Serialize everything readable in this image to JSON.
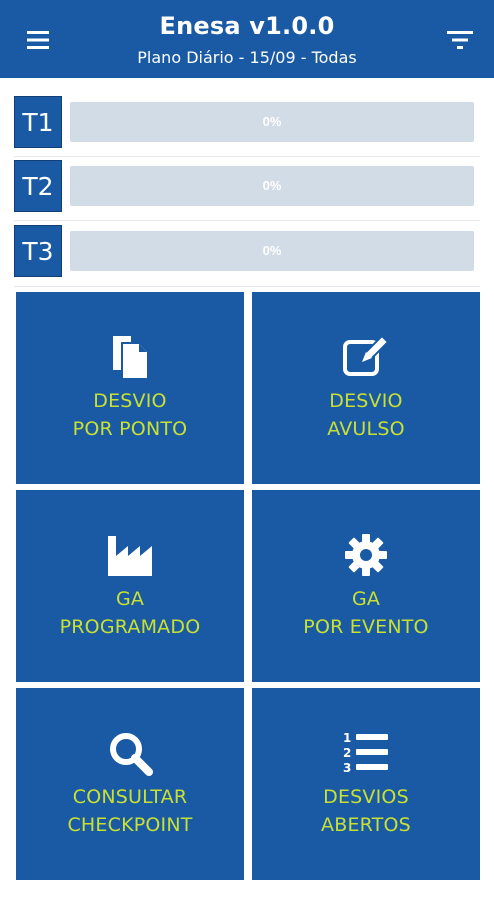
{
  "header": {
    "title": "Enesa v1.0.0",
    "subtitle": "Plano Diário - 15/09 - Todas",
    "menu_icon": "hamburger-menu-icon",
    "filter_icon": "filter-icon",
    "background": "#1a5aa5"
  },
  "progress": [
    {
      "label": "T1",
      "percent_text": "0%",
      "value": 0
    },
    {
      "label": "T2",
      "percent_text": "0%",
      "value": 0
    },
    {
      "label": "T3",
      "percent_text": "0%",
      "value": 0
    }
  ],
  "tiles": [
    {
      "line1": "DESVIO",
      "line2": "POR PONTO",
      "icon": "documents-icon"
    },
    {
      "line1": "DESVIO",
      "line2": "AVULSO",
      "icon": "edit-icon"
    },
    {
      "line1": "GA",
      "line2": "PROGRAMADO",
      "icon": "factory-icon"
    },
    {
      "line1": "GA",
      "line2": "POR EVENTO",
      "icon": "gear-icon"
    },
    {
      "line1": "CONSULTAR",
      "line2": "CHECKPOINT",
      "icon": "search-icon"
    },
    {
      "line1": "DESVIOS",
      "line2": "ABERTOS",
      "icon": "numbered-list-icon"
    }
  ],
  "colors": {
    "primary": "#1a5aa5",
    "tile_text": "#c8e032",
    "bar_track": "#d2dce6"
  }
}
